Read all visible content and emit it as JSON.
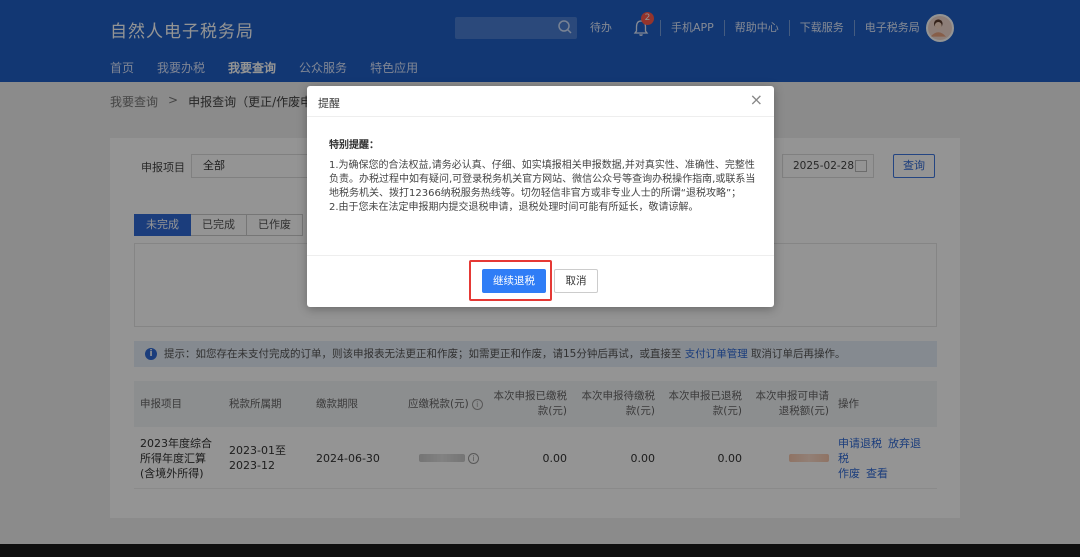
{
  "header": {
    "logo": "自然人电子税务局",
    "todo_label": "待办",
    "notification_count": "2",
    "links": [
      "手机APP",
      "帮助中心",
      "下载服务",
      "电子税务局"
    ],
    "nav": [
      "首页",
      "我要办税",
      "我要查询",
      "公众服务",
      "特色应用"
    ],
    "active_nav": "我要查询"
  },
  "breadcrumb": {
    "parent": "我要查询",
    "separator": ">",
    "current": "申报查询（更正/作废申报"
  },
  "filters": {
    "project_label": "申报项目",
    "project_value": "全部",
    "end_date": "2025-02-28",
    "query_label": "查询"
  },
  "tabs": [
    "未完成",
    "已完成",
    "已作废"
  ],
  "notice": {
    "icon": "info-icon",
    "text_before": "提示：如您存在未支付完成的订单，则该申报表无法更正和作废；如需更正和作废，请15分钟后再试，或直接至",
    "link": "支付订单管理",
    "text_after": "取消订单后再操作。"
  },
  "table": {
    "headers": [
      "申报项目",
      "税款所属期",
      "缴款期限",
      "应缴税款(元)",
      "本次申报已缴税款(元)",
      "本次申报待缴税款(元)",
      "本次申报已退税款(元)",
      "本次申报可申请退税额(元)",
      "操作"
    ],
    "rows": [
      {
        "project": "2023年度综合所得年度汇算(含境外所得)",
        "period": "2023-01至2023-12",
        "deadline": "2024-06-30",
        "paid": "0.00",
        "pending": "0.00",
        "refunded": "0.00",
        "actions": [
          "申请退税",
          "放弃退税",
          "作废",
          "查看"
        ]
      }
    ]
  },
  "modal": {
    "title": "提醒",
    "close_icon": "close-icon",
    "heading": "特别提醒：",
    "paragraph1": "1.为确保您的合法权益,请务必认真、仔细、如实填报相关申报数据,并对真实性、准确性、完整性负责。办税过程中如有疑问,可登录税务机关官方网站、微信公众号等查询办税操作指南,或联系当地税务机关、拨打12366纳税服务热线等。切勿轻信非官方或非专业人士的所谓“退税攻略”；",
    "paragraph2": "2.由于您未在法定申报期内提交退税申请，退税处理时间可能有所延长，敬请谅解。",
    "continue_label": "继续退税",
    "cancel_label": "取消"
  }
}
